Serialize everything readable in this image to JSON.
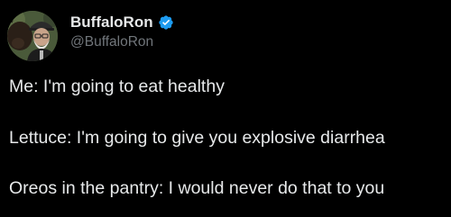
{
  "author": {
    "display_name": "BuffaloRon",
    "handle": "@BuffaloRon",
    "verified": true,
    "verified_color": "#1d9bf0",
    "avatar_icon": "profile-photo-man-with-buffalo"
  },
  "tweet": {
    "lines": [
      "Me: I'm going to eat healthy",
      "Lettuce: I'm going to give you explosive diarrhea",
      "Oreos in the pantry: I would never do that to you"
    ]
  },
  "colors": {
    "background": "#000000",
    "text": "#e7e9ea",
    "secondary_text": "#71767b"
  }
}
